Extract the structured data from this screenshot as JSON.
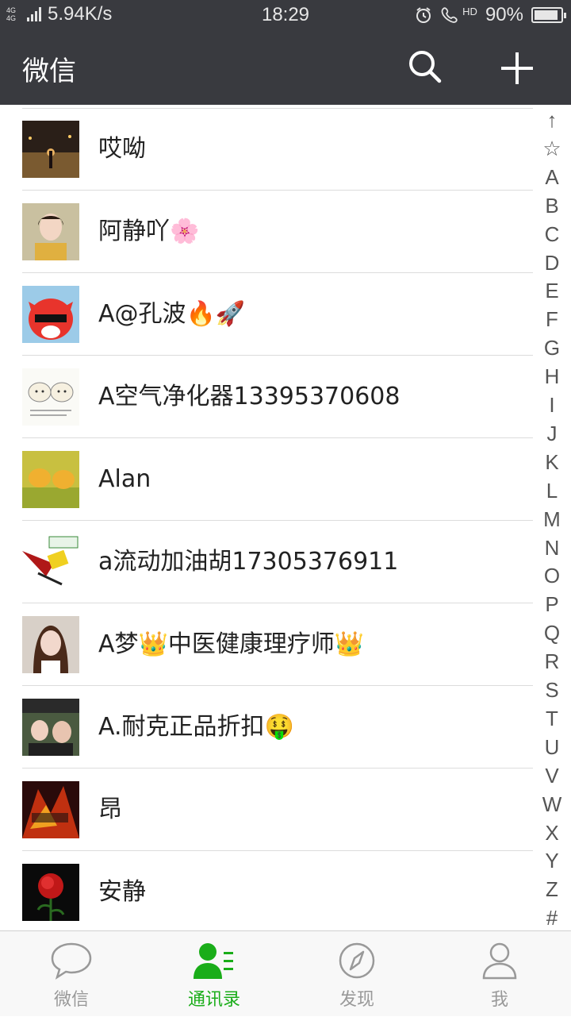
{
  "status_bar": {
    "network": "4G 4G",
    "speed": "5.94K/s",
    "time": "18:29",
    "hd": "HD",
    "battery": "90%",
    "battery_level": 0.9
  },
  "header": {
    "title": "微信",
    "search_icon": "search-icon",
    "add_icon": "plus-icon"
  },
  "contacts": [
    {
      "name": "哎呦"
    },
    {
      "name": "阿静吖🌸"
    },
    {
      "name": "A@孔波🔥🚀"
    },
    {
      "name": "A空气净化器13395370608"
    },
    {
      "name": "Alan"
    },
    {
      "name": "a流动加油胡17305376911"
    },
    {
      "name": "A梦👑中医健康理疗师👑"
    },
    {
      "name": "A.耐克正品折扣🤑"
    },
    {
      "name": "昂"
    },
    {
      "name": "安静"
    }
  ],
  "index": [
    "↑",
    "☆",
    "A",
    "B",
    "C",
    "D",
    "E",
    "F",
    "G",
    "H",
    "I",
    "J",
    "K",
    "L",
    "M",
    "N",
    "O",
    "P",
    "Q",
    "R",
    "S",
    "T",
    "U",
    "V",
    "W",
    "X",
    "Y",
    "Z",
    "#"
  ],
  "tabs": [
    {
      "label": "微信",
      "icon": "chat-bubble-icon",
      "active": false
    },
    {
      "label": "通讯录",
      "icon": "contacts-icon",
      "active": true
    },
    {
      "label": "发现",
      "icon": "compass-icon",
      "active": false
    },
    {
      "label": "我",
      "icon": "person-icon",
      "active": false
    }
  ],
  "colors": {
    "header_bg": "#393a3f",
    "accent": "#1aad19",
    "tab_inactive": "#999999"
  }
}
